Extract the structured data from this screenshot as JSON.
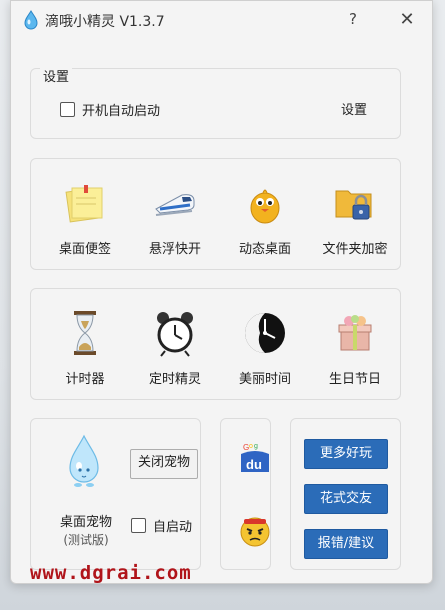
{
  "window": {
    "title": "滴哦小精灵 V1.3.7",
    "help_glyph": "?",
    "close_glyph": "✕"
  },
  "settings": {
    "legend": "设置",
    "autostart_label": "开机自动启动",
    "autostart_checked": false,
    "settings_button": "设置"
  },
  "tools_row1": [
    {
      "label": "桌面便签",
      "icon": "sticky-notes-icon"
    },
    {
      "label": "悬浮快开",
      "icon": "bullet-train-icon"
    },
    {
      "label": "动态桌面",
      "icon": "chick-icon"
    },
    {
      "label": "文件夹加密",
      "icon": "locked-folder-icon"
    }
  ],
  "tools_row2": [
    {
      "label": "计时器",
      "icon": "hourglass-icon"
    },
    {
      "label": "定时精灵",
      "icon": "alarm-clock-icon"
    },
    {
      "label": "美丽时间",
      "icon": "clock-face-icon"
    },
    {
      "label": "生日节日",
      "icon": "gift-box-icon"
    }
  ],
  "pet": {
    "close_pet_button": "关闭宠物",
    "label": "桌面宠物",
    "sublabel": "(测试版)",
    "autostart_label": "自启动",
    "autostart_checked": false
  },
  "side_icons": [
    "google-du-icon",
    "angry-face-icon"
  ],
  "links": {
    "more_fun": "更多好玩",
    "fancy_friends": "花式交友",
    "report": "报错/建议"
  },
  "watermark": "www.dgrai.com",
  "colors": {
    "accent_blue": "#2b6cb8",
    "watermark_red": "#b0141a"
  }
}
